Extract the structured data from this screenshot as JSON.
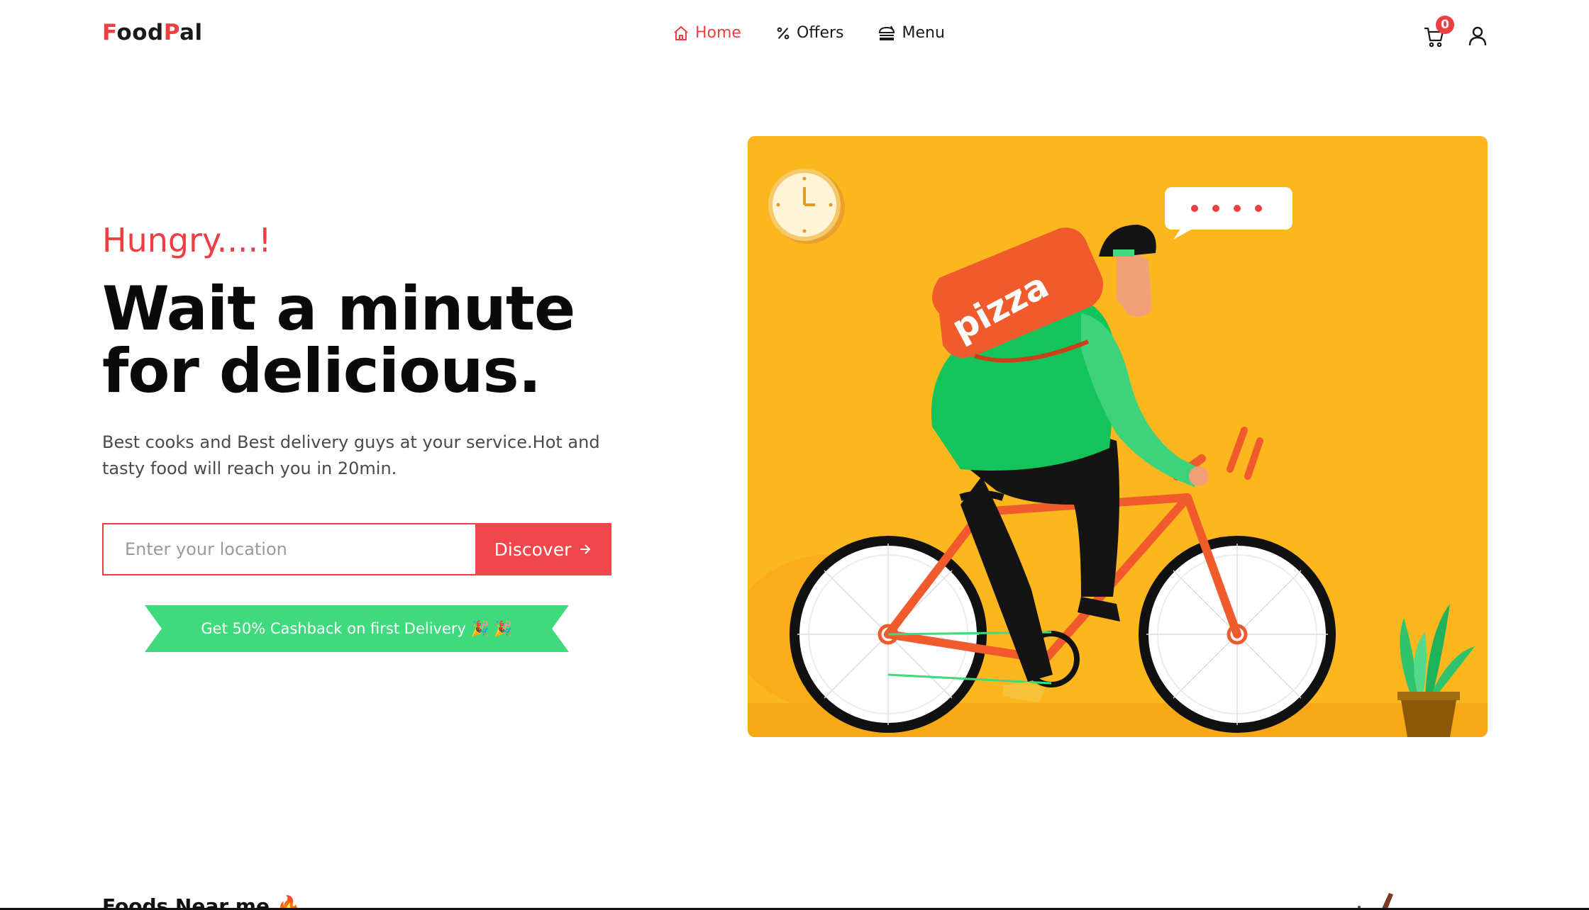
{
  "header": {
    "logo_first": "F",
    "logo_mid": "ood",
    "logo_p": "P",
    "logo_end": "al",
    "nav": [
      {
        "label": "Home",
        "icon": "home-icon",
        "active": true
      },
      {
        "label": "Offers",
        "icon": "percent-icon",
        "active": false
      },
      {
        "label": "Menu",
        "icon": "burger-icon",
        "active": false
      }
    ],
    "cart_count": "0"
  },
  "hero": {
    "kicker": "Hungry....!",
    "title_line1": "Wait a minute",
    "title_line2": "for delicious.",
    "subtitle": "Best cooks and Best delivery guys at your service.Hot and tasty food will reach you in 20min.",
    "search_placeholder": "Enter your location",
    "discover_label": "Discover",
    "cashback_text": "Get 50% Cashback on first Delivery 🎉 🎉",
    "illustration_text": "pizza"
  },
  "section": {
    "title": "Foods Near me 🔥"
  },
  "colors": {
    "accent": "#ef3e42",
    "ribbon": "#3fda7e",
    "illustration_bg": "#fdb71e"
  }
}
